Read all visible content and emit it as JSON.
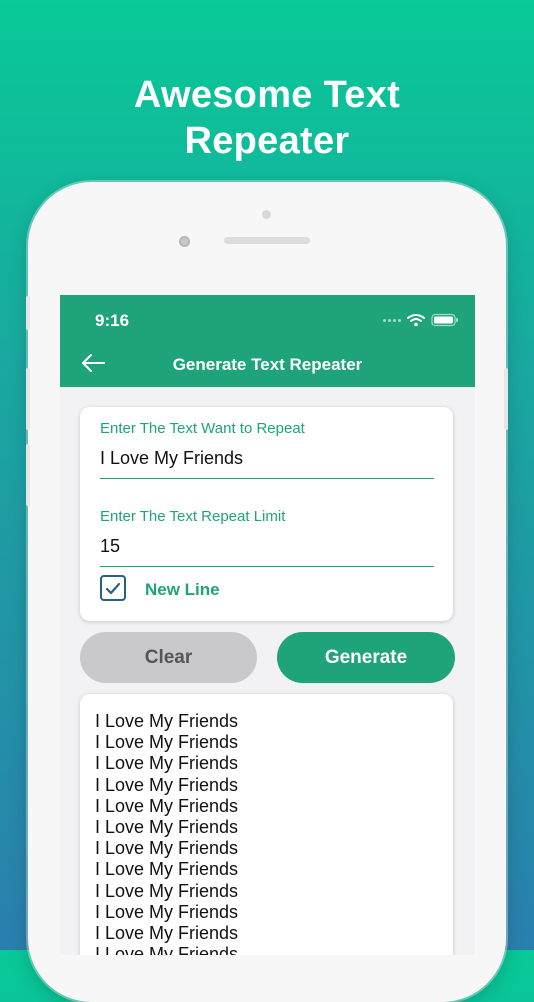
{
  "headline": {
    "line1": "Awesome Text",
    "line2": "Repeater"
  },
  "status_bar": {
    "time": "9:16"
  },
  "app_bar": {
    "title": "Generate Text Repeater",
    "back_icon": "arrow-left-icon"
  },
  "form": {
    "text_label": "Enter The Text Want to Repeat",
    "text_value": "I Love My Friends",
    "limit_label": "Enter The Text Repeat Limit",
    "limit_value": "15",
    "new_line_label": "New Line",
    "new_line_checked": true
  },
  "buttons": {
    "clear": "Clear",
    "generate": "Generate"
  },
  "output": {
    "lines": [
      "I Love My Friends",
      "I Love My Friends",
      "I Love My Friends",
      "I Love My Friends",
      "I Love My Friends",
      "I Love My Friends",
      "I Love My Friends",
      "I Love My Friends",
      "I Love My Friends",
      "I Love My Friends",
      "I Love My Friends",
      "I Love My Friends"
    ]
  },
  "colors": {
    "accent": "#1fa37a",
    "checkbox": "#2a5f86",
    "clear_bg": "#c9c9cc"
  }
}
